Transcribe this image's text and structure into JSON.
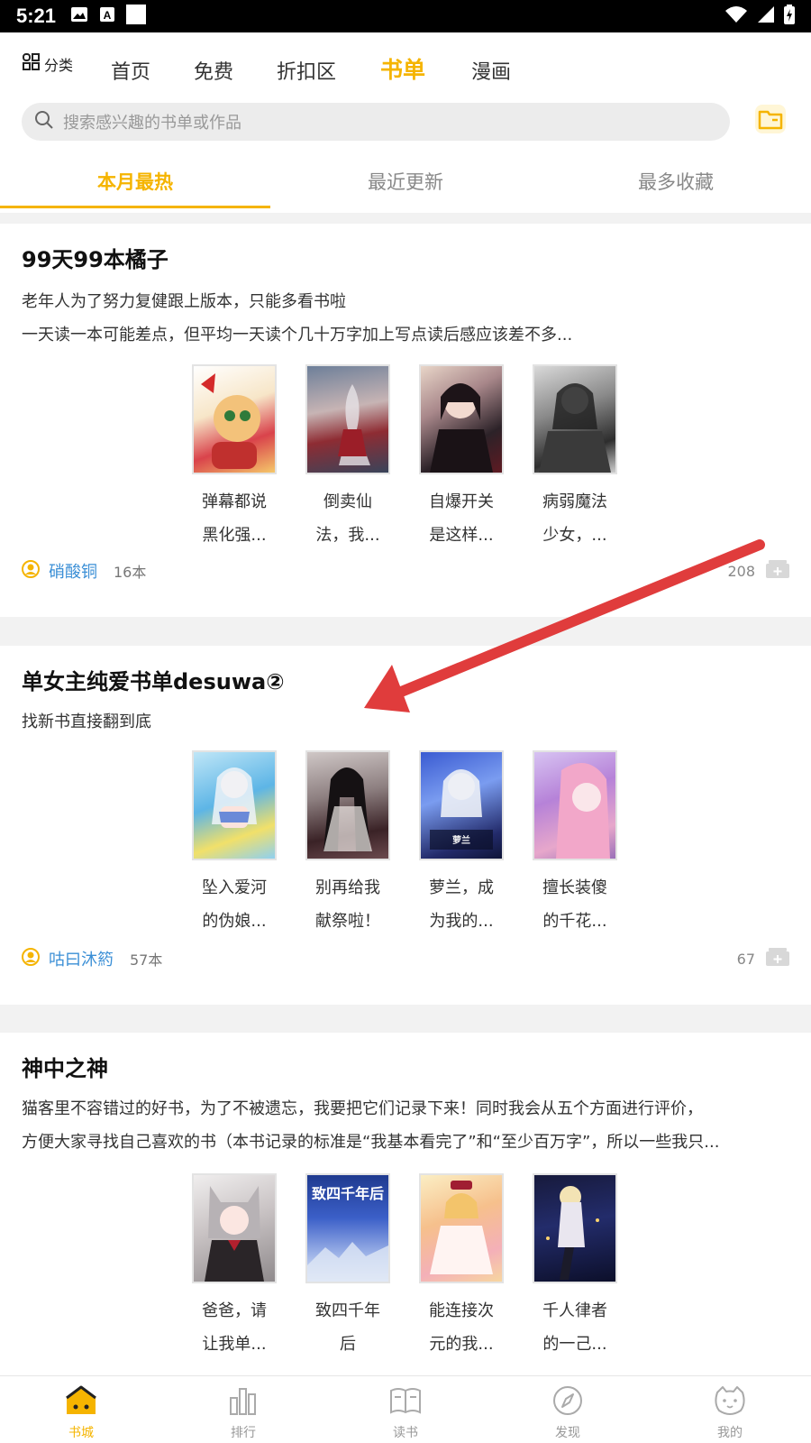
{
  "status_bar": {
    "time": "5:21"
  },
  "top_nav": {
    "category_label": "分类",
    "tabs": [
      {
        "label": "首页",
        "active": false
      },
      {
        "label": "免费",
        "active": false
      },
      {
        "label": "折扣区",
        "active": false
      },
      {
        "label": "书单",
        "active": true
      },
      {
        "label": "漫画",
        "active": false
      }
    ]
  },
  "search": {
    "placeholder": "搜索感兴趣的书单或作品"
  },
  "sub_tabs": [
    {
      "label": "本月最热",
      "active": true
    },
    {
      "label": "最近更新",
      "active": false
    },
    {
      "label": "最多收藏",
      "active": false
    }
  ],
  "booklists": [
    {
      "title": "99天99本橘子",
      "description": [
        "老年人为了努力复健跟上版本，只能多看书啦",
        "一天读一本可能差点，但平均一天读个几十万字加上写点读后感应该差不多..."
      ],
      "books": [
        {
          "name_line1": "弹幕都说",
          "name_line2": "黑化强..."
        },
        {
          "name_line1": "倒卖仙",
          "name_line2": "法，我..."
        },
        {
          "name_line1": "自爆开关",
          "name_line2": "是这样..."
        },
        {
          "name_line1": "病弱魔法",
          "name_line2": "少女，..."
        }
      ],
      "author": "硝酸铜",
      "book_count": "16本",
      "favorites": "208"
    },
    {
      "title": "单女主纯爱书单desuwa②",
      "description": [
        "找新书直接翻到底"
      ],
      "books": [
        {
          "name_line1": "坠入爱河",
          "name_line2": "的伪娘..."
        },
        {
          "name_line1": "别再给我",
          "name_line2": "献祭啦！"
        },
        {
          "name_line1": "萝兰，成",
          "name_line2": "为我的..."
        },
        {
          "name_line1": "擅长装傻",
          "name_line2": "的千花..."
        }
      ],
      "author": "咕曰沐箹",
      "book_count": "57本",
      "favorites": "67"
    },
    {
      "title": "神中之神",
      "description": [
        "猫客里不容错过的好书，为了不被遗忘，我要把它们记录下来！同时我会从五个方面进行评价，",
        "方便大家寻找自己喜欢的书（本书记录的标准是“我基本看完了”和“至少百万字”，所以一些我只..."
      ],
      "books": [
        {
          "name_line1": "爸爸，请",
          "name_line2": "让我单..."
        },
        {
          "name_line1": "致四千年",
          "name_line2": "后"
        },
        {
          "name_line1": "能连接次",
          "name_line2": "元的我..."
        },
        {
          "name_line1": "千人律者",
          "name_line2": "的一己..."
        }
      ]
    }
  ],
  "bottom_nav": [
    {
      "label": "书城",
      "icon": "home-icon",
      "active": true
    },
    {
      "label": "排行",
      "icon": "bar-chart-icon",
      "active": false
    },
    {
      "label": "读书",
      "icon": "book-icon",
      "active": false
    },
    {
      "label": "发现",
      "icon": "compass-icon",
      "active": false
    },
    {
      "label": "我的",
      "icon": "cat-face-icon",
      "active": false
    }
  ],
  "colors": {
    "accent": "#f5b400",
    "author_link": "#3b8fd6",
    "arrow": "#e03c3c"
  }
}
